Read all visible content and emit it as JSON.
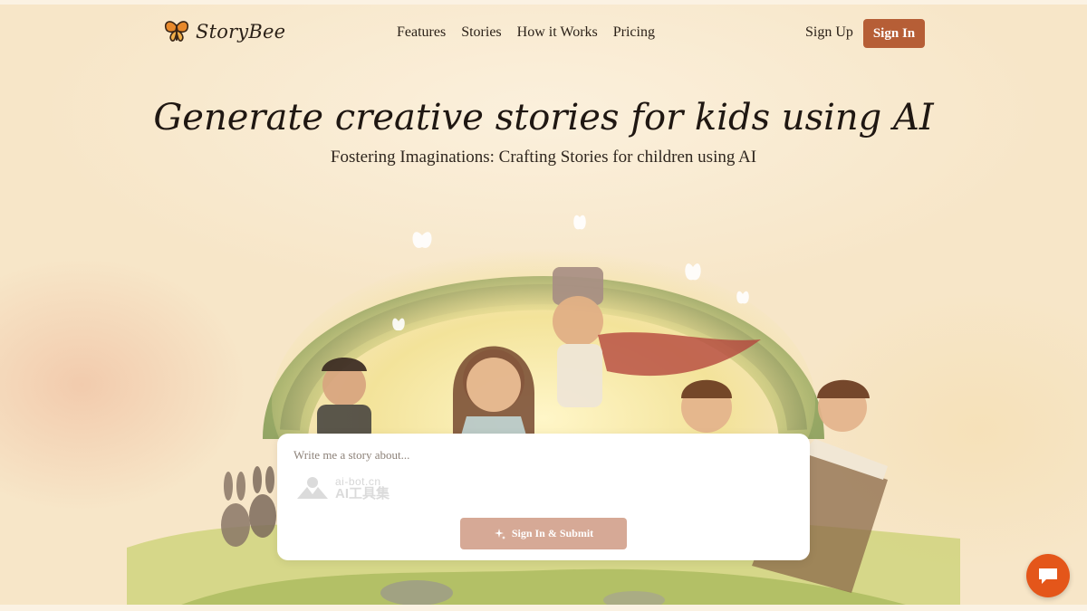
{
  "brand": {
    "name": "StoryBee"
  },
  "nav": {
    "links": [
      "Features",
      "Stories",
      "How it Works",
      "Pricing"
    ],
    "signup_label": "Sign Up",
    "signin_label": "Sign In"
  },
  "hero": {
    "title": "Generate creative stories for kids using AI",
    "subtitle": "Fostering Imaginations: Crafting Stories for children using AI"
  },
  "prompt": {
    "placeholder": "Write me a story about...",
    "value": "",
    "submit_label": "Sign In & Submit"
  },
  "watermark": {
    "line1": "ai-bot.cn",
    "line2": "AI工具集"
  },
  "colors": {
    "accent": "#b65e36",
    "submit_disabled": "#d6a996",
    "chat_button": "#e4561a",
    "background": "#fbf2e3"
  },
  "icons": {
    "logo": "butterfly-icon",
    "submit": "sparkle-icon",
    "chat": "chat-bubble-icon"
  }
}
